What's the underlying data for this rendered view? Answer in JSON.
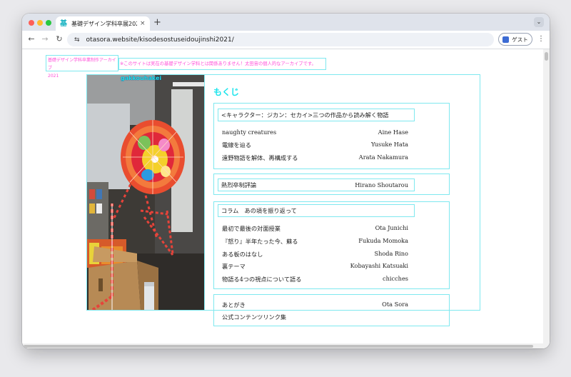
{
  "browser": {
    "tab_title": "基礎デザイン学科卒展2021同人誌",
    "tab_close": "×",
    "new_tab": "+",
    "tab_menu": "⌄",
    "url": "otasora.website/kisodesostuseidoujinshi2021/",
    "guest_label": "ゲスト",
    "favicon": "基",
    "nav": {
      "back": "←",
      "forward": "→",
      "reload": "↻",
      "site_info": "⇆",
      "menu": "⋮"
    }
  },
  "page": {
    "site_title_line1": "基礎デザイン学科卒業制作アーカイブ",
    "site_title_line2": "2021",
    "disclaimer": "※このサイトは実在の基礎デザイン学科とは関係ありません！太田宙の個人的なアーカイブです。",
    "photo_label": "gakkouhakei",
    "toc_heading": "もくじ",
    "colors": {
      "accent": "#19e4ec",
      "pink": "#ff4fd8",
      "frame": "#7fe8ef"
    },
    "sections": [
      {
        "title": "<キャラクター：ジカン：セカイ>三つの作品から読み解く物語",
        "entries": [
          {
            "title": "naughty creatures",
            "author": "Aine Hase"
          },
          {
            "title": "電線を辿る",
            "author": "Yusuke Hata"
          },
          {
            "title": "遠野物語を解体、再構成する",
            "author": "Arata Nakamura"
          }
        ]
      },
      {
        "title": "熱烈卒制評論",
        "author": "Hirano Shoutarou",
        "entries": []
      },
      {
        "title": "コラム　あの頃を振り返って",
        "entries": [
          {
            "title": "最初で最後の対面授業",
            "author": "Ota Junichi"
          },
          {
            "title": "『怒り』半年たった今、蘇る",
            "author": "Fukuda Momoka"
          },
          {
            "title": "ある板のはなし",
            "author": "Shoda Rino"
          },
          {
            "title": "裏テーマ",
            "author": "Kobayashi Katsuaki"
          },
          {
            "title": "物語る4つの視点について語る",
            "author": "chicches"
          }
        ]
      },
      {
        "title": "",
        "entries": [
          {
            "title": "あとがき",
            "author": "Ota Sora"
          },
          {
            "title": "公式コンテンツリンク集",
            "author": ""
          }
        ]
      }
    ]
  }
}
